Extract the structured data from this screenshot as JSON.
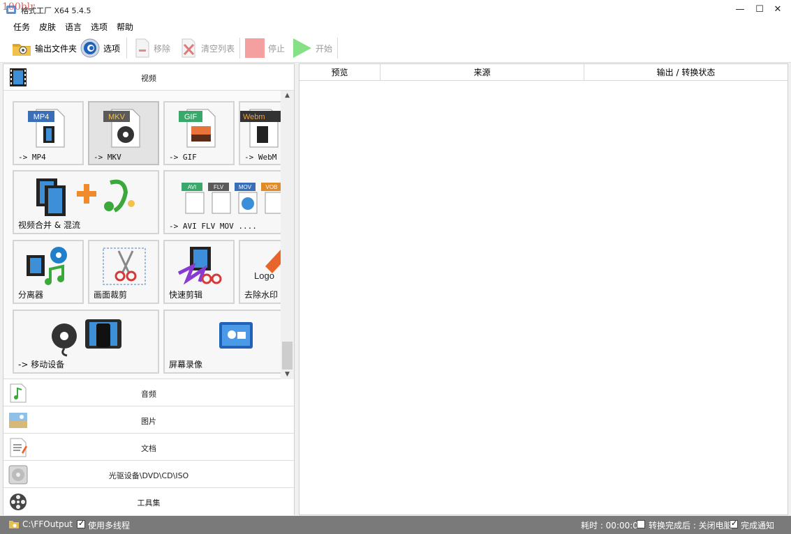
{
  "window": {
    "watermark": "100blr",
    "title": "格式工厂 X64 5.4.5",
    "controls": {
      "minimize": "—",
      "maximize": "☐",
      "close": "✕"
    }
  },
  "menu": [
    "任务",
    "皮肤",
    "语言",
    "选项",
    "帮助"
  ],
  "toolbar": {
    "output_folder": "输出文件夹",
    "options": "选项",
    "remove": "移除",
    "clear_list": "清空列表",
    "stop": "停止",
    "start": "开始"
  },
  "categories": {
    "video": "视频",
    "audio": "音频",
    "image": "图片",
    "document": "文档",
    "rom": "光驱设备\\DVD\\CD\\ISO",
    "tools": "工具集"
  },
  "tiles": {
    "mp4": {
      "badge": "MP4",
      "label": "-> MP4"
    },
    "mkv": {
      "badge": "MKV",
      "label": "-> MKV"
    },
    "gif": {
      "badge": "GIF",
      "label": "-> GIF"
    },
    "webm": {
      "badge": "Webm",
      "label": "-> WebM"
    },
    "merge": {
      "label": "视频合并 & 混流"
    },
    "multi": {
      "badges": [
        "AVI",
        "FLV",
        "MOV",
        "VOB"
      ],
      "label": "-> AVI FLV MOV ...."
    },
    "splitter": {
      "label": "分离器"
    },
    "crop": {
      "label": "画面裁剪"
    },
    "quickcut": {
      "label": "快速剪辑"
    },
    "watermark": {
      "label": "去除水印",
      "logo": "Logo"
    },
    "mobile": {
      "label": "-> 移动设备"
    },
    "record": {
      "label": "屏幕录像"
    }
  },
  "task_table": {
    "columns": [
      "预览",
      "来源",
      "输出 / 转换状态"
    ]
  },
  "status": {
    "output_path": "C:\\FFOutput",
    "multithread": "使用多线程",
    "multithread_checked": true,
    "elapsed": "耗时 : 00:00:00",
    "after_convert": "转换完成后 : 关闭电脑",
    "after_convert_checked": false,
    "notify": "完成通知",
    "notify_checked": true
  },
  "colors": {
    "mp4_badge": "#3a6fb7",
    "mkv_badge": "#5a5a5a",
    "gif_badge": "#3aa86b",
    "webm_badge": "#333333",
    "stop_icon": "#f28c8c",
    "start_icon": "#7ed87e",
    "statusbar": "#7a7a7a"
  }
}
